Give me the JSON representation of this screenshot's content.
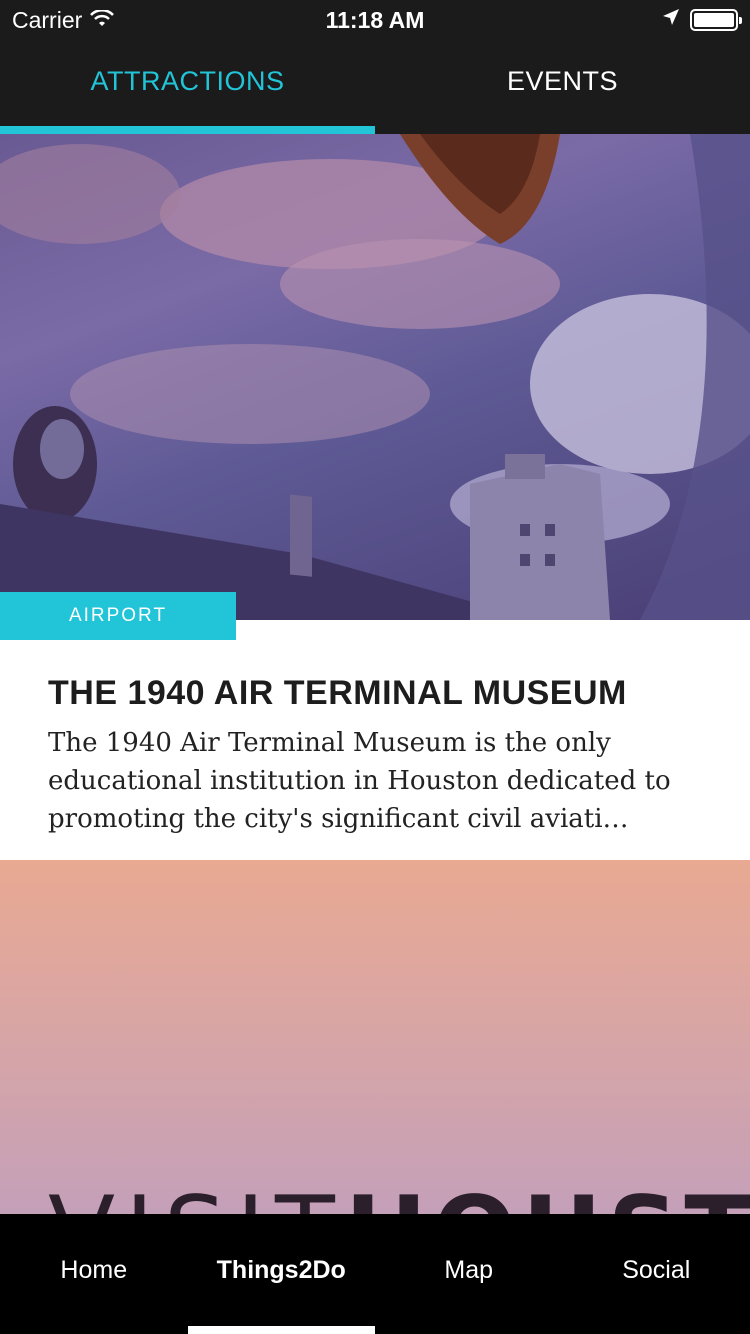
{
  "status_bar": {
    "carrier": "Carrier",
    "time": "11:18 AM",
    "icons": [
      "wifi-icon",
      "location-arrow-icon",
      "battery-icon"
    ]
  },
  "top_tabs": [
    {
      "label": "ATTRACTIONS",
      "active": true
    },
    {
      "label": "EVENTS",
      "active": false
    }
  ],
  "cards": [
    {
      "category": "AIRPORT",
      "title": "THE 1940 AIR TERMINAL MUSEUM",
      "description": "The 1940 Air Terminal Museum is the only educational institution in Houston dedicated to promoting the city's significant civil aviati…"
    },
    {
      "logo_text_light": "VISIT",
      "logo_text_bold": "HOUSTON"
    }
  ],
  "bottom_nav": [
    {
      "label": "Home",
      "active": false
    },
    {
      "label": "Things2Do",
      "active": true
    },
    {
      "label": "Map",
      "active": false
    },
    {
      "label": "Social",
      "active": false
    }
  ],
  "colors": {
    "accent": "#22c4d8",
    "bar_background": "#1b1b1b",
    "nav_background": "#000000"
  }
}
